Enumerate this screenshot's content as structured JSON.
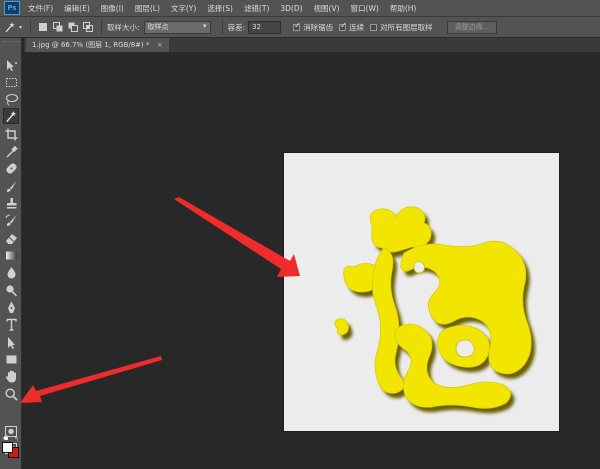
{
  "app": {
    "logo_text": "Ps"
  },
  "menu": [
    "文件(F)",
    "编辑(E)",
    "图像(I)",
    "图层(L)",
    "文字(Y)",
    "选择(S)",
    "滤镜(T)",
    "3D(D)",
    "视图(V)",
    "窗口(W)",
    "帮助(H)"
  ],
  "options": {
    "sample_size_label": "取样大小:",
    "sample_size_value": "取样点",
    "tolerance_label": "容差:",
    "tolerance_value": "32",
    "antialias_label": "消除锯齿",
    "antialias_checked": true,
    "contiguous_label": "连续",
    "contiguous_checked": true,
    "all_layers_label": "对所有图层取样",
    "all_layers_checked": false,
    "refine_edge_label": "调整边缘..."
  },
  "document": {
    "tab_title": "1.jpg @ 66.7% (图层 1, RGB/8#)",
    "tab_modified": "*",
    "tab_close": "×"
  },
  "colors": {
    "foreground": "#ffffff",
    "background": "#d7151c",
    "canvas_fill": "#ececec",
    "glyph_fill": "#f2e600",
    "glyph_shadow": "#6b6100",
    "arrow": "#ef2b2b"
  },
  "tools": [
    "move-tool-icon",
    "marquee-tool-icon",
    "lasso-tool-icon",
    "magic-wand-tool-icon",
    "crop-tool-icon",
    "eyedropper-tool-icon",
    "spot-healing-tool-icon",
    "brush-tool-icon",
    "clone-stamp-tool-icon",
    "history-brush-tool-icon",
    "eraser-tool-icon",
    "gradient-tool-icon",
    "blur-tool-icon",
    "dodge-tool-icon",
    "pen-tool-icon",
    "type-tool-icon",
    "path-selection-tool-icon",
    "rectangle-tool-icon",
    "hand-tool-icon",
    "zoom-tool-icon"
  ]
}
